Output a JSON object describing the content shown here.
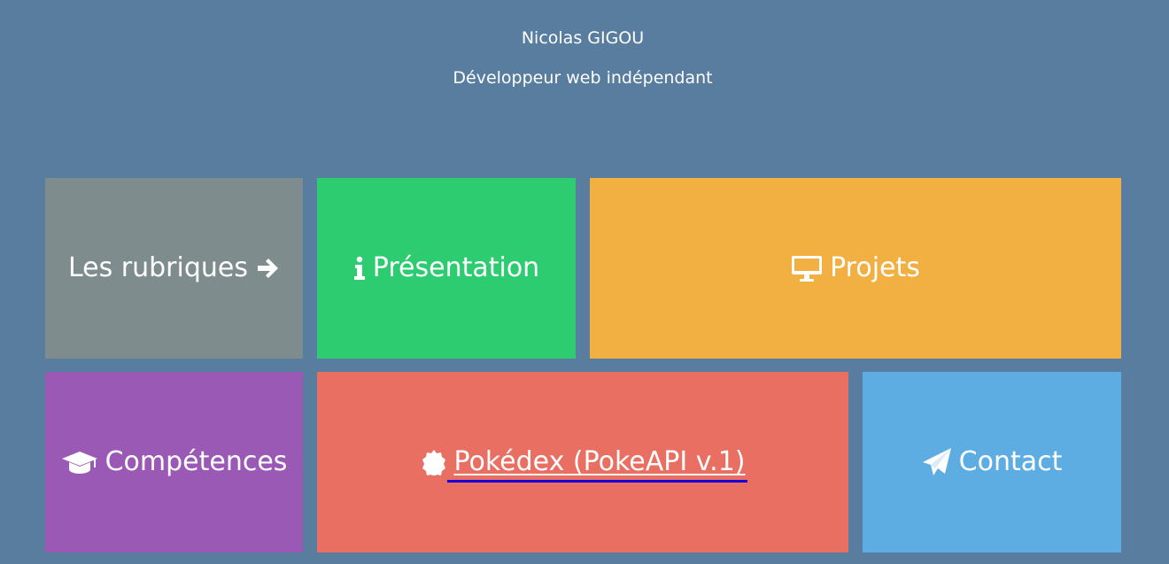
{
  "header": {
    "name": "Nicolas GIGOU",
    "subtitle": "Développeur web indépendant"
  },
  "tiles": [
    {
      "label": "Les rubriques",
      "icon": "arrow-right-icon",
      "color": "#7f8c8d"
    },
    {
      "label": "Présentation",
      "icon": "info-icon",
      "color": "#2ecc71"
    },
    {
      "label": "Projets",
      "icon": "monitor-icon",
      "color": "#f3b042"
    },
    {
      "label": "Compétences",
      "icon": "graduation-cap-icon",
      "color": "#9b59b6"
    },
    {
      "label": "Pokédex (PokeAPI v.1)",
      "icon": "badge-icon",
      "color": "#ea6f63"
    },
    {
      "label": "Contact",
      "icon": "paper-plane-icon",
      "color": "#5dade2"
    }
  ],
  "colors": {
    "background": "#587d9e",
    "text": "#ffffff",
    "link_underline": "#1500d6"
  }
}
